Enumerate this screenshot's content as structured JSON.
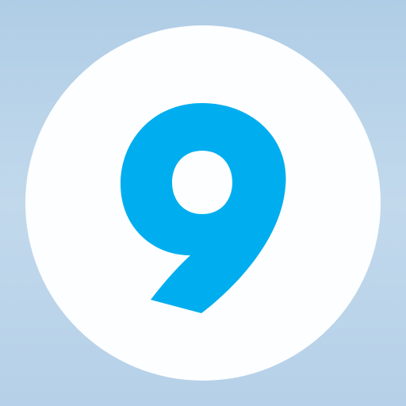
{
  "app_icon": {
    "digit": "9",
    "colors": {
      "background_top": "#afcde6",
      "background_bottom": "#b5d0e8",
      "circle": "#fdfeff",
      "digit": "#00aeef"
    }
  }
}
